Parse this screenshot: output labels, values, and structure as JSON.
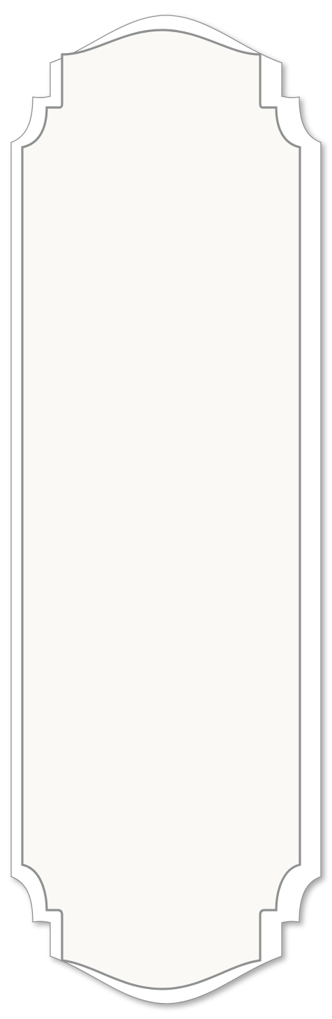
{
  "frame": {
    "colors": {
      "outer_fill": "#ffffff",
      "outer_stroke": "#8e8e8e",
      "inner_fill": "#faf9f6",
      "inner_stroke": "#8f9191",
      "shadow": "#9a9a9a",
      "page_background": "#ffffff"
    }
  }
}
